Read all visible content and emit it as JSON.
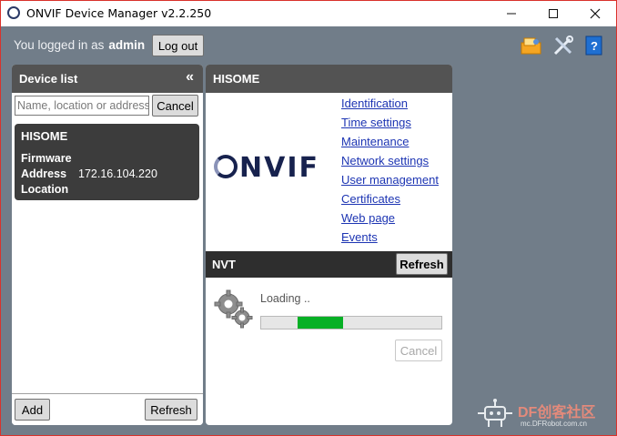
{
  "window": {
    "title": "ONVIF Device Manager v2.2.250",
    "controls": {
      "minimize": "minimize-icon",
      "maximize": "maximize-icon",
      "close": "close-icon"
    }
  },
  "topbar": {
    "logged_text": "You logged in as",
    "username": "admin",
    "logout_label": "Log out",
    "icons": [
      "debug-icon",
      "tools-icon",
      "help-book-icon"
    ]
  },
  "device_list": {
    "title": "Device list",
    "collapse_glyph": "«",
    "search_placeholder": "Name, location or address",
    "cancel_label": "Cancel",
    "devices": [
      {
        "name": "HISOME",
        "firmware_label": "Firmware",
        "firmware_value": "",
        "address_label": "Address",
        "address_value": "172.16.104.220",
        "location_label": "Location",
        "location_value": ""
      }
    ],
    "add_label": "Add",
    "refresh_label": "Refresh"
  },
  "device_detail": {
    "title": "HISOME",
    "logo_text": "NVIF",
    "links": [
      "Identification",
      "Time settings",
      "Maintenance",
      "Network settings",
      "User management",
      "Certificates",
      "Web page",
      "Events"
    ],
    "nvt": {
      "title": "NVT",
      "refresh_label": "Refresh",
      "loading_text": "Loading ..",
      "progress_fraction": 0.25,
      "cancel_label": "Cancel"
    }
  },
  "watermark": {
    "brand": "DF创客社区",
    "url": "mc.DFRobot.com.cn"
  },
  "colors": {
    "background": "#717d89",
    "panel_header": "#535353",
    "link": "#1d35b3",
    "progress": "#06b025",
    "window_border": "#d9322b"
  }
}
